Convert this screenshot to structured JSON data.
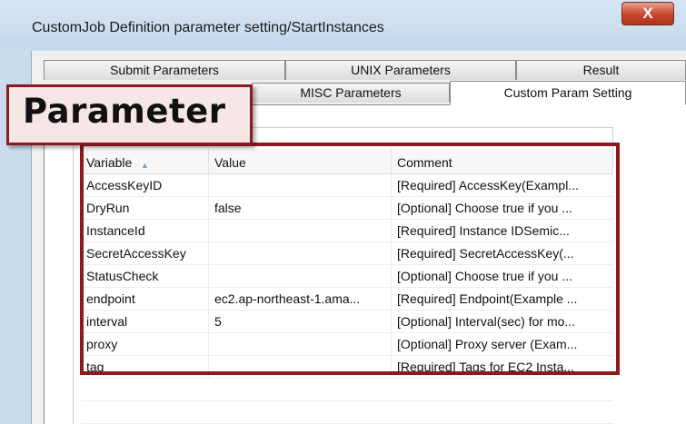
{
  "window": {
    "title": "CustomJob Definition parameter setting/StartInstances",
    "close_symbol": "X"
  },
  "tabs_row1": [
    "Submit Parameters",
    "UNIX Parameters",
    "Result"
  ],
  "tabs_row2": [
    "MISC Parameters",
    "Custom Param Setting"
  ],
  "active_tab": "Custom Param Setting",
  "callout": {
    "label": "Parameter"
  },
  "table": {
    "columns": [
      "Variable",
      "Value",
      "Comment"
    ],
    "sorted_column": "Variable",
    "rows": [
      {
        "variable": "AccessKeyID",
        "value": "",
        "comment": "[Required] AccessKey(Exampl..."
      },
      {
        "variable": "DryRun",
        "value": "false",
        "comment": "[Optional] Choose true if you ..."
      },
      {
        "variable": "InstanceId",
        "value": "",
        "comment": "[Required] Instance IDSemic..."
      },
      {
        "variable": "SecretAccessKey",
        "value": "",
        "comment": "[Required] SecretAccessKey(..."
      },
      {
        "variable": "StatusCheck",
        "value": "",
        "comment": "[Optional] Choose true if you ..."
      },
      {
        "variable": "endpoint",
        "value": "ec2.ap-northeast-1.ama...",
        "comment": "[Required] Endpoint(Example ..."
      },
      {
        "variable": "interval",
        "value": "5",
        "comment": "[Optional] Interval(sec) for mo..."
      },
      {
        "variable": "proxy",
        "value": "",
        "comment": "[Optional] Proxy server (Exam..."
      },
      {
        "variable": "tag",
        "value": "",
        "comment": "[Required] Tags for EC2 Insta..."
      }
    ]
  },
  "colors": {
    "highlight": "#8b1a1e",
    "callout_bg": "#f6e6e6",
    "titlebar": "#c9dcee"
  }
}
